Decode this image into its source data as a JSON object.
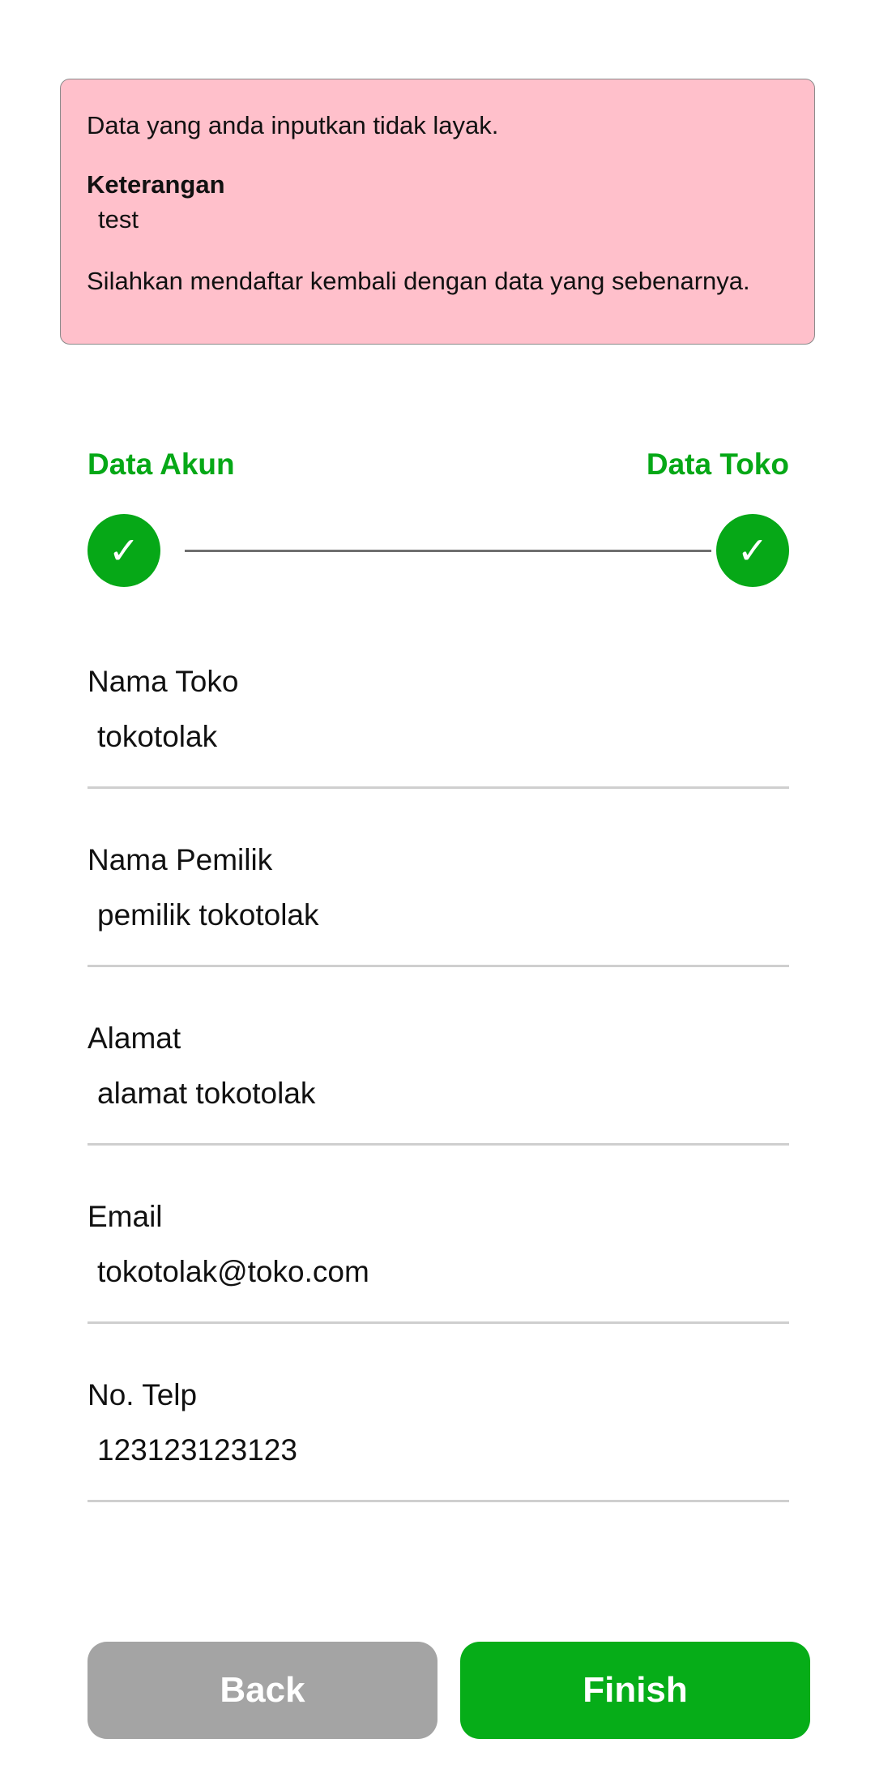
{
  "alert": {
    "message": "Data yang anda inputkan tidak layak.",
    "heading": "Keterangan",
    "note": "test",
    "footer": "Silahkan mendaftar kembali dengan data yang sebenarnya.",
    "background_color": "#ffc0cb"
  },
  "steps": [
    {
      "label": "Data Akun",
      "status": "completed",
      "icon": "check-icon"
    },
    {
      "label": "Data Toko",
      "status": "completed",
      "icon": "check-icon"
    }
  ],
  "form": {
    "fields": [
      {
        "label": "Nama Toko",
        "value": "tokotolak"
      },
      {
        "label": "Nama Pemilik",
        "value": "pemilik tokotolak"
      },
      {
        "label": "Alamat",
        "value": "alamat tokotolak"
      },
      {
        "label": "Email",
        "value": "tokotolak@toko.com"
      },
      {
        "label": "No. Telp",
        "value": "123123123123"
      }
    ]
  },
  "buttons": {
    "back_label": "Back",
    "finish_label": "Finish"
  },
  "colors": {
    "accent_green": "#06a817",
    "back_button": "#a4a4a4"
  }
}
